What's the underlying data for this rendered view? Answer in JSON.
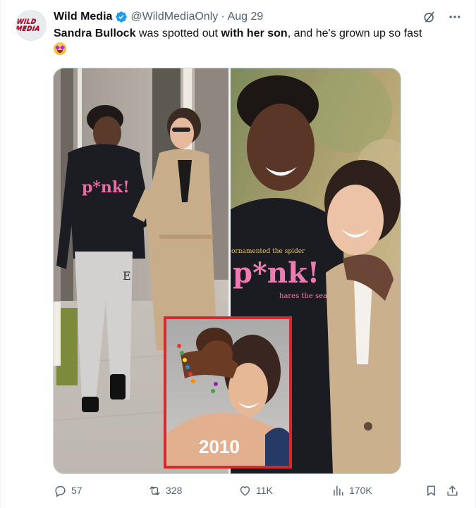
{
  "author": {
    "name": "Wild Media",
    "handle": "@WildMediaOnly",
    "date": "Aug 29",
    "avatar_logo": "WILD MEDIA"
  },
  "tweet": {
    "part1_bold": "Sandra Bullock",
    "part2": " was spotted out ",
    "part3_bold": "with her son",
    "part4": ", and he's grown up so fast"
  },
  "media": {
    "inset_year": "2010",
    "hoodie_text_main": "p*nk!",
    "hoodie_text_top": "ornamented the spider",
    "hoodie_text_bottom": "hares the sease",
    "pants_logo": "E"
  },
  "actions": {
    "replies": "57",
    "reposts": "328",
    "likes": "11K",
    "views": "170K"
  },
  "icons": [
    "verified-badge-icon",
    "grok-icon",
    "more-icon",
    "reply-icon",
    "repost-icon",
    "like-icon",
    "views-icon",
    "bookmark-icon",
    "share-icon"
  ],
  "colors": {
    "text": "#0f1419",
    "muted": "#536471",
    "verified": "#1d9bf0",
    "inset_border": "#d7282f"
  }
}
